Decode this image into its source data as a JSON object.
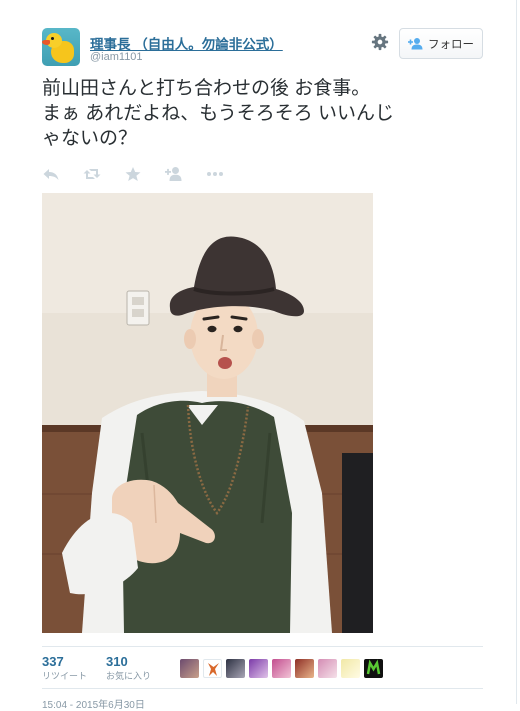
{
  "tweet": {
    "user": {
      "display_name": "理事長 （自由人。勿論非公式）",
      "handle": "@iam1101",
      "avatar_icon": "duck-icon"
    },
    "follow_button_label": "フォロー",
    "text_lines": [
      "前山田さんと打ち合わせの後 お食事。",
      "まぁ あれだよね、もうそろそろ いいんじ",
      "ゃないの？"
    ],
    "actions": [
      "reply-icon",
      "retweet-icon",
      "favorite-icon",
      "follow-user-icon",
      "more-icon"
    ],
    "stats": {
      "retweets": {
        "count": "337",
        "label": "リツイート"
      },
      "favorites": {
        "count": "310",
        "label": "お気に入り"
      }
    },
    "timestamp": "15:04 - 2015年6月30日",
    "colors": {
      "link": "#2b6e99",
      "muted": "#8899a6",
      "text": "#292f33",
      "border": "#e1e8ed"
    }
  }
}
